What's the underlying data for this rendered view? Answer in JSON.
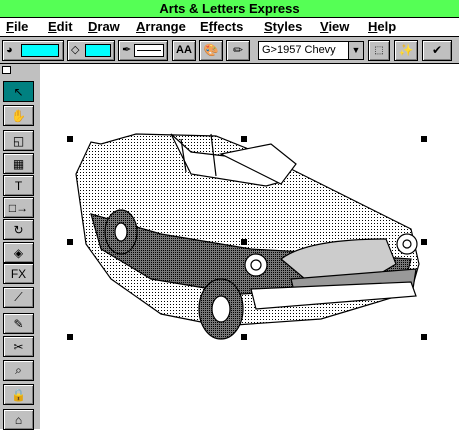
{
  "window": {
    "title": "Arts & Letters Express"
  },
  "menu": [
    {
      "label": "File",
      "key": "F",
      "rest": "ile"
    },
    {
      "label": "Edit",
      "key": "E",
      "rest": "dit"
    },
    {
      "label": "Draw",
      "key": "D",
      "rest": "raw"
    },
    {
      "label": "Arrange",
      "key": "A",
      "rest": "rrange"
    },
    {
      "label": "Effects",
      "key": "f",
      "pre": "E",
      "rest": "fects"
    },
    {
      "label": "Styles",
      "key": "S",
      "rest": "tyles"
    },
    {
      "label": "View",
      "key": "V",
      "rest": "iew"
    },
    {
      "label": "Help",
      "key": "H",
      "rest": "elp"
    }
  ],
  "toolbar": {
    "line_color": "#00ffff",
    "fill_color": "#00ffff",
    "text_button": "AA",
    "symbol_combo": "G>1957 Chevy",
    "combo_arrow": "▼"
  },
  "tools": [
    {
      "name": "pointer-tool",
      "glyph": "↖",
      "active": true
    },
    {
      "name": "hand-tool",
      "glyph": "✋"
    },
    {
      "name": "shapes-tool",
      "glyph": "◱"
    },
    {
      "name": "symbols-tool",
      "glyph": "▦"
    },
    {
      "name": "text-tool",
      "glyph": "T"
    },
    {
      "name": "blend-tool",
      "glyph": "□→"
    },
    {
      "name": "rotate-tool",
      "glyph": "↻"
    },
    {
      "name": "color-tool",
      "glyph": "◈"
    },
    {
      "name": "fx-tool",
      "glyph": "FX"
    },
    {
      "name": "line-tool",
      "glyph": "⟋"
    },
    {
      "name": "pen-tool",
      "glyph": "✎"
    },
    {
      "name": "cut-tool",
      "glyph": "✂"
    },
    {
      "name": "zoom-tool",
      "glyph": "⌕"
    },
    {
      "name": "lock-tool",
      "glyph": "🔒"
    },
    {
      "name": "paint-tool",
      "glyph": "⌂"
    }
  ],
  "colors": {
    "title_bar": "#55ff55",
    "active_tool": "#008080",
    "chrome": "#c0c0c0"
  }
}
